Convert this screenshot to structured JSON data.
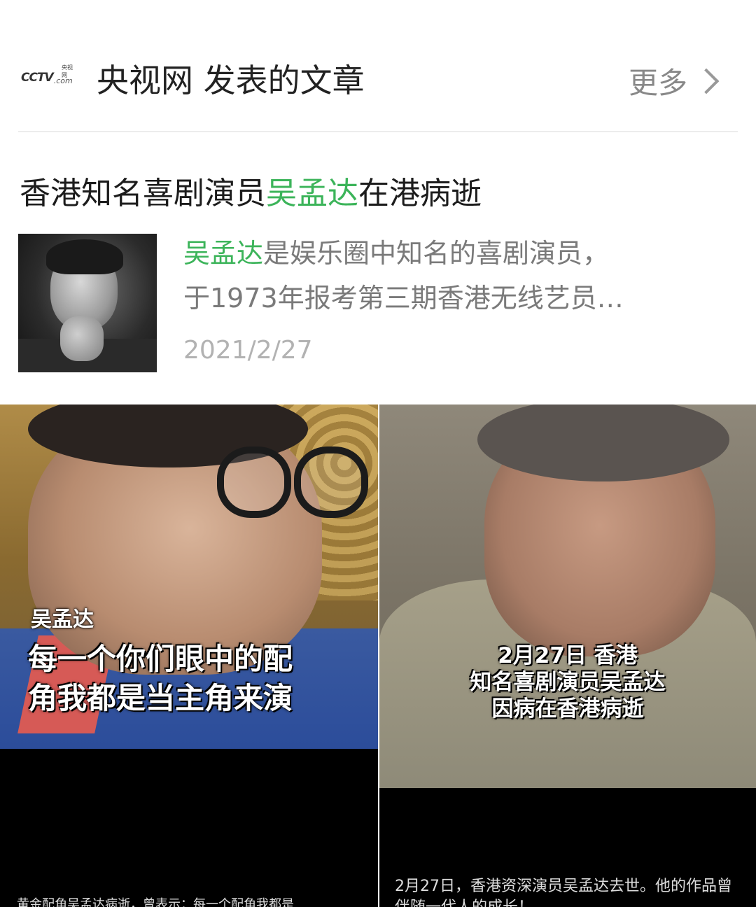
{
  "header": {
    "logo_main": "CCTV",
    "logo_com": ".com",
    "logo_small": "央视网",
    "title": "央视网 发表的文章",
    "more_label": "更多"
  },
  "article": {
    "title_prefix": "香港知名喜剧演员",
    "title_highlight": "吴孟达",
    "title_suffix": "在港病逝",
    "summary_highlight": "吴孟达",
    "summary_line1_rest": "是娱乐圈中知名的喜剧演员，",
    "summary_line2": "于1973年报考第三期香港无线艺员…",
    "date": "2021/2/27"
  },
  "videos": [
    {
      "name_tag": "吴孟达",
      "caption_line1": "每一个你们眼中的配",
      "caption_line2": "角我都是当主角来演",
      "bottom_caption": "黄金配角吴孟达病逝，曾表示：每一个配角我都是"
    },
    {
      "caption_line1": "2月27日 香港",
      "caption_line2": "知名喜剧演员吴孟达",
      "caption_line3": "因病在香港病逝",
      "desc_line1": "2月27日，香港资深演员吴孟达去世。他的作品曾",
      "desc_line2": "伴随一代人的成长！"
    }
  ],
  "colors": {
    "highlight_green": "#3cb45a",
    "text_dark": "#1c1c1c",
    "text_gray": "#7a7a7a",
    "date_gray": "#b2b2b2",
    "logo_red": "#d0211c"
  }
}
